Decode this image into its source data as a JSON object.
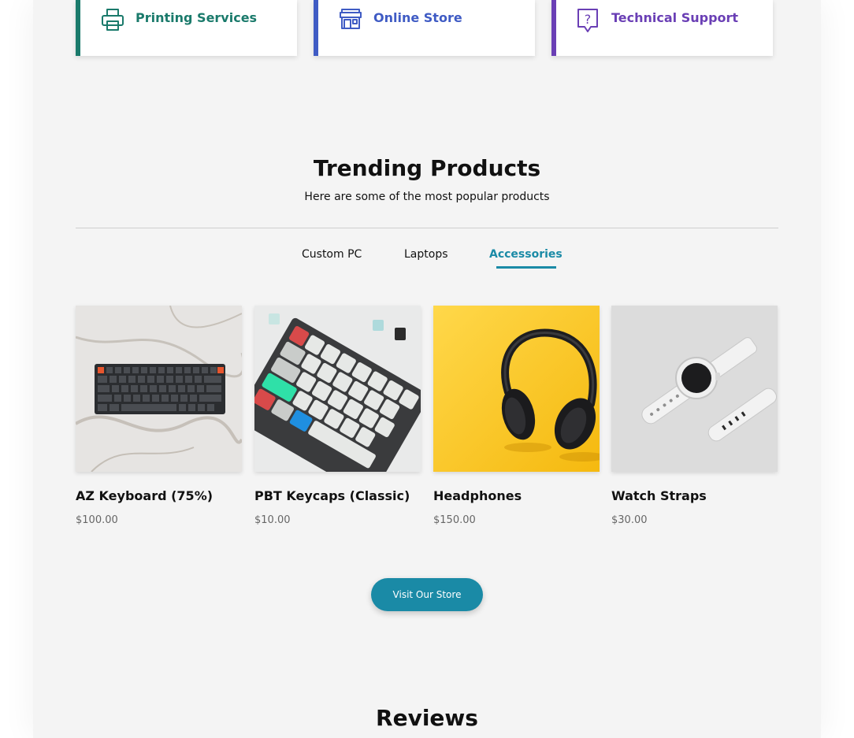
{
  "services": [
    {
      "label": "Printing Services",
      "icon": "printer-icon",
      "color": "#1a7a6b"
    },
    {
      "label": "Online Store",
      "icon": "store-icon",
      "color": "#3f5bc4"
    },
    {
      "label": "Technical Support",
      "icon": "help-bubble-icon",
      "color": "#6a3fb5"
    }
  ],
  "trending": {
    "title": "Trending Products",
    "subtitle": "Here are some of the most popular products",
    "tabs": [
      {
        "label": "Custom PC",
        "active": false
      },
      {
        "label": "Laptops",
        "active": false
      },
      {
        "label": "Accessories",
        "active": true
      }
    ],
    "accent": "#1a8aa6"
  },
  "products": [
    {
      "name": "AZ Keyboard (75%)",
      "price": "$100.00",
      "image": "keyboard-on-marble"
    },
    {
      "name": "PBT Keycaps (Classic)",
      "price": "$10.00",
      "image": "keycaps-closeup"
    },
    {
      "name": "Headphones",
      "price": "$150.00",
      "image": "headphones-on-yellow"
    },
    {
      "name": "Watch Straps",
      "price": "$30.00",
      "image": "white-smartwatch"
    }
  ],
  "store_button": {
    "label": "Visit Our Store"
  },
  "reviews": {
    "title": "Reviews"
  }
}
